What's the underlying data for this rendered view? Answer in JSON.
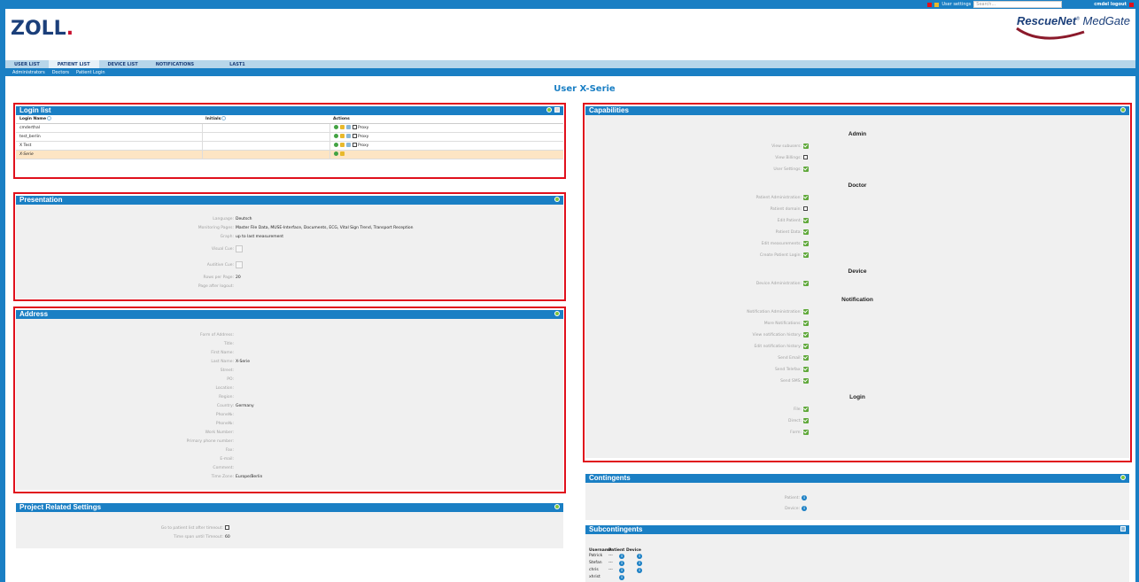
{
  "topbar": {
    "user_settings": "User settings",
    "search_placeholder": "Search...",
    "user_logout": "cmdel logout"
  },
  "logos": {
    "zoll": "ZOLL",
    "rescuenet": "RescueNet",
    "medgate": "MedGate"
  },
  "nav": {
    "tabs": [
      "USER LIST",
      "PATIENT LIST",
      "DEVICE LIST",
      "NOTIFICATIONS",
      "LAST1"
    ],
    "subtabs": [
      "Administrators",
      "Doctors",
      "Patient Login"
    ]
  },
  "page_title": "User X-Serie",
  "login_list": {
    "title": "Login list",
    "headers": [
      "Login Name",
      "Initials",
      "Actions"
    ],
    "proxy_label": "Proxy",
    "rows": [
      {
        "name": "cmderthal"
      },
      {
        "name": "test_berlin"
      },
      {
        "name": "X Test"
      },
      {
        "name": "X-Serie"
      }
    ]
  },
  "presentation": {
    "title": "Presentation",
    "language_label": "Language:",
    "language_value": "Deutsch",
    "monitoring_label": "Monitoring Pages:",
    "monitoring_value": "Master File Data, MUSE-Interface, Documents, ECG, Vital Sign Trend, Transport Reception",
    "graph_label": "Graph:",
    "graph_value": "up to last measurement",
    "visual_label": "Visual Cue:",
    "auditive_label": "Auditive Cue:",
    "rows_label": "Rows per Page:",
    "rows_value": "20",
    "page_after_label": "Page after logout:"
  },
  "address": {
    "title": "Address",
    "fields": [
      {
        "label": "Form of Address:",
        "value": ""
      },
      {
        "label": "Title:",
        "value": ""
      },
      {
        "label": "First Name:",
        "value": ""
      },
      {
        "label": "Last Name:",
        "value": "X-Serie"
      },
      {
        "label": "Street:",
        "value": ""
      },
      {
        "label": "PO:",
        "value": ""
      },
      {
        "label": "Location:",
        "value": ""
      },
      {
        "label": "Region:",
        "value": ""
      },
      {
        "label": "Country:",
        "value": "Germany"
      },
      {
        "label": "Phone№:",
        "value": ""
      },
      {
        "label": "Phone№:",
        "value": ""
      },
      {
        "label": "Work Number:",
        "value": ""
      },
      {
        "label": "Primary phone number:",
        "value": ""
      },
      {
        "label": "Fax:",
        "value": ""
      },
      {
        "label": "E-mail:",
        "value": ""
      },
      {
        "label": "Comment:",
        "value": ""
      },
      {
        "label": "Time Zone:",
        "value": "Europe/Berlin"
      }
    ]
  },
  "project": {
    "title": "Project Related Settings",
    "goto_label": "Go to patient list after timeout:",
    "timeout_label": "Time span until Timeout:",
    "timeout_value": "60"
  },
  "capabilities": {
    "title": "Capabilities",
    "sections": [
      {
        "heading": "Admin",
        "items": [
          {
            "label": "View subusers:",
            "checked": true
          },
          {
            "label": "View Billings:",
            "checked": false
          },
          {
            "label": "User Settings:",
            "checked": true
          }
        ]
      },
      {
        "heading": "Doctor",
        "items": [
          {
            "label": "Patient Administration:",
            "checked": true
          },
          {
            "label": "Patient domain:",
            "checked": false
          },
          {
            "label": "Edit Patient:",
            "checked": true
          },
          {
            "label": "Patient Data:",
            "checked": true
          },
          {
            "label": "Edit measurements:",
            "checked": true
          },
          {
            "label": "Create Patient Login:",
            "checked": true
          }
        ]
      },
      {
        "heading": "Device",
        "items": [
          {
            "label": "Device Administration:",
            "checked": true
          }
        ]
      },
      {
        "heading": "Notification",
        "items": [
          {
            "label": "Notification Administration:",
            "checked": true
          },
          {
            "label": "More Notifications:",
            "checked": true
          },
          {
            "label": "View notification history:",
            "checked": true
          },
          {
            "label": "Edit notification history:",
            "checked": true
          },
          {
            "label": "Send Email:",
            "checked": true
          },
          {
            "label": "Send Telefax:",
            "checked": true
          },
          {
            "label": "Send SMS:",
            "checked": true
          }
        ]
      },
      {
        "heading": "Login",
        "items": [
          {
            "label": "File:",
            "checked": true
          },
          {
            "label": "Direct:",
            "checked": true
          },
          {
            "label": "Form:",
            "checked": true
          }
        ]
      }
    ]
  },
  "contingents": {
    "title": "Contingents",
    "patient_label": "Patient:",
    "device_label": "Device:"
  },
  "subcontingents": {
    "title": "Subcontingents",
    "headers": [
      "Username",
      "Patient",
      "Device"
    ],
    "rows": [
      {
        "user": "Patrick",
        "patient": "---"
      },
      {
        "user": "Stefan",
        "patient": "---"
      },
      {
        "user": "chris",
        "patient": "---"
      },
      {
        "user": "xhrist",
        "patient": ""
      }
    ]
  }
}
